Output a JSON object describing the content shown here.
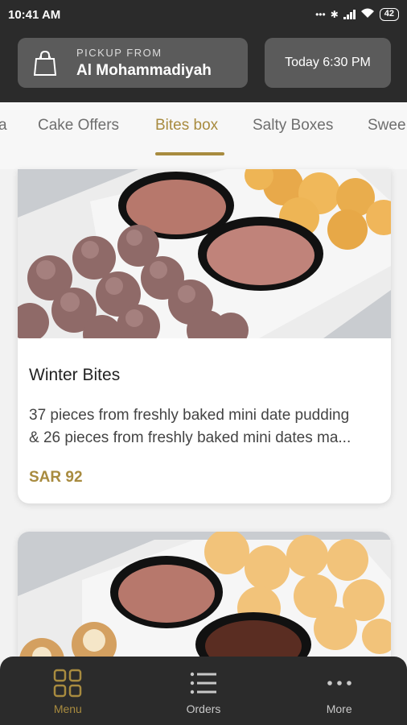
{
  "status": {
    "time": "10:41 AM",
    "battery": "42"
  },
  "pickup": {
    "label": "PICKUP FROM",
    "location": "Al Mohammadiyah",
    "time": "Today 6:30 PM"
  },
  "tabs": [
    {
      "label": "a"
    },
    {
      "label": "Cake Offers"
    },
    {
      "label": "Bites box"
    },
    {
      "label": "Salty Boxes"
    },
    {
      "label": "Swee"
    }
  ],
  "products": [
    {
      "title": "Winter Bites",
      "desc_line1": "37 pieces from freshly baked mini date pudding",
      "desc_line2": "& 26 pieces from freshly baked mini dates ma...",
      "price": "SAR 92"
    }
  ],
  "nav": [
    {
      "label": "Menu",
      "icon": "grid-icon"
    },
    {
      "label": "Orders",
      "icon": "list-icon"
    },
    {
      "label": "More",
      "icon": "dots-icon"
    }
  ],
  "colors": {
    "accent": "#a88b3f",
    "dark": "#2b2b2b",
    "button": "#5b5b5b"
  }
}
